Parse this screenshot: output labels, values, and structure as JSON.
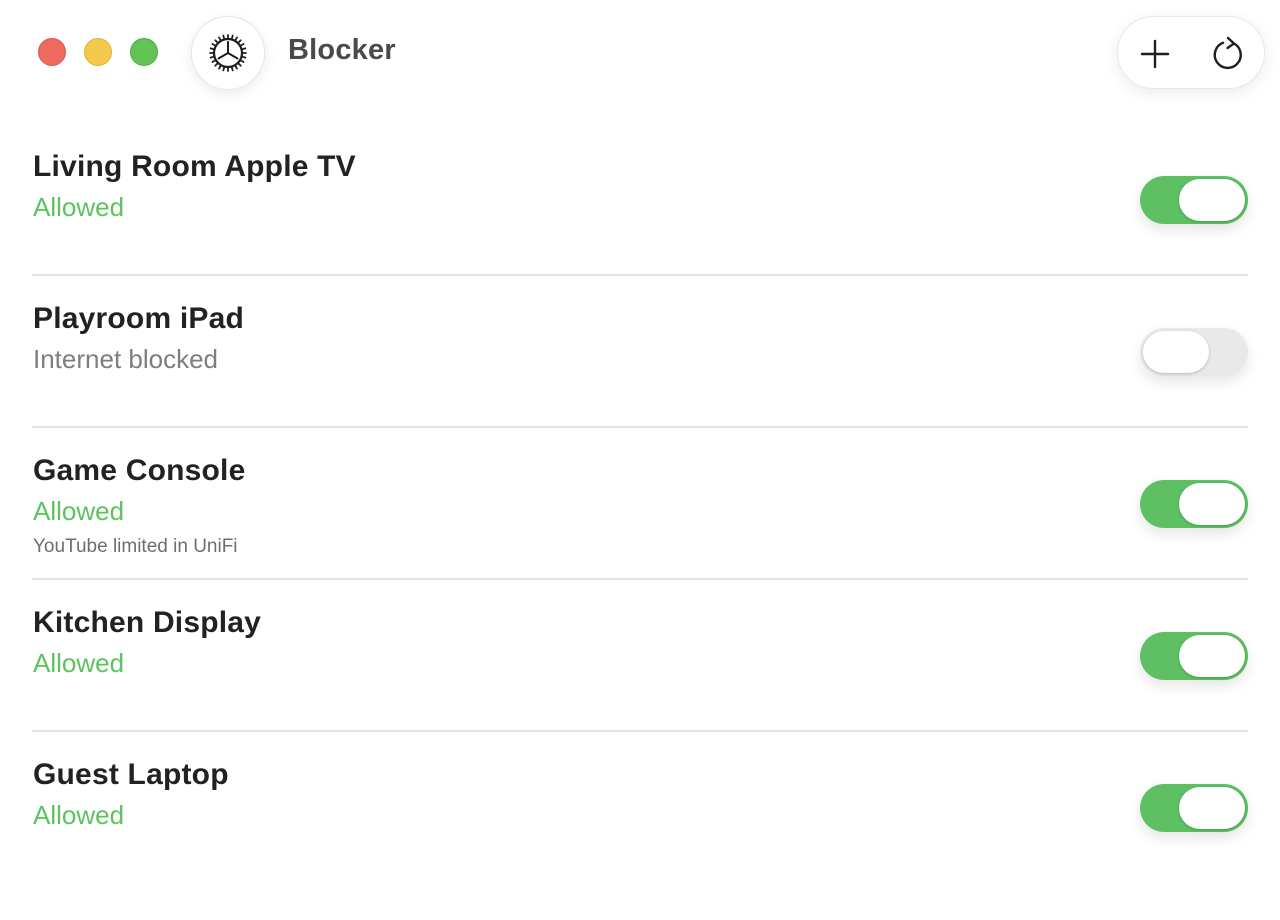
{
  "window": {
    "title": "Blocker",
    "controls": [
      "close",
      "minimize",
      "zoom"
    ]
  },
  "toolbar": {
    "settings_icon": "gear-icon",
    "add_icon": "plus-icon",
    "refresh_icon": "refresh-icon"
  },
  "colors": {
    "allowed": "#5ec35f",
    "toggle_on": "#5ec062",
    "toggle_off": "#e9e9e9"
  },
  "devices": [
    {
      "name": "Living Room Apple TV",
      "status": "Allowed",
      "note": "",
      "enabled": true
    },
    {
      "name": "Playroom iPad",
      "status": "Internet blocked",
      "note": "",
      "enabled": false
    },
    {
      "name": "Game Console",
      "status": "Allowed",
      "note": "YouTube limited in UniFi",
      "enabled": true
    },
    {
      "name": "Kitchen Display",
      "status": "Allowed",
      "note": "",
      "enabled": true
    },
    {
      "name": "Guest Laptop",
      "status": "Allowed",
      "note": "",
      "enabled": true
    }
  ]
}
